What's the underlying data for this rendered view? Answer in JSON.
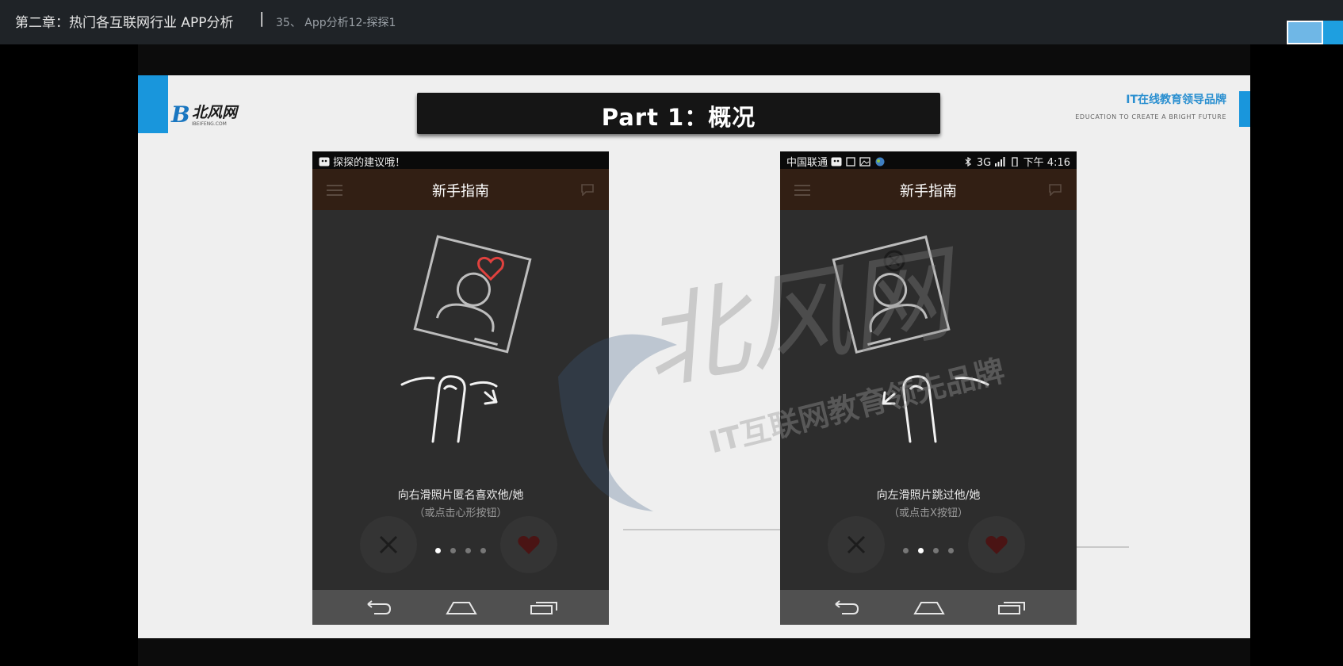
{
  "player": {
    "chapter_title": "第二章：热门各互联网行业 APP分析",
    "separator": "|",
    "lesson_title": "35、 App分析12-探探1"
  },
  "slide": {
    "logo": {
      "mark": "B",
      "name": "北风网",
      "url": "IBEIFENG.COM"
    },
    "title": "Part 1：概况",
    "brand_cn": "IT在线教育领导品牌",
    "brand_en": "EDUCATION TO CREATE A BRIGHT FUTURE",
    "watermark": {
      "logo": "北风网",
      "slogan": "IT互联网教育领先品牌"
    },
    "accent_color": "#1996dc"
  },
  "phones": [
    {
      "status_text": "探探的建议哦！",
      "app_title": "新手指南",
      "caption": "向右滑照片匿名喜欢他/她",
      "subcaption": "（或点击心形按钮）",
      "card_icon": "heart-icon",
      "swipe_direction": "right",
      "active_dot": 0
    },
    {
      "carrier": "中国联通",
      "network": "3G",
      "time": "下午 4:16",
      "app_title": "新手指南",
      "caption": "向左滑照片跳过他/她",
      "subcaption": "（或点击X按钮）",
      "card_icon": "close-circle-icon",
      "swipe_direction": "left",
      "active_dot": 1
    }
  ]
}
